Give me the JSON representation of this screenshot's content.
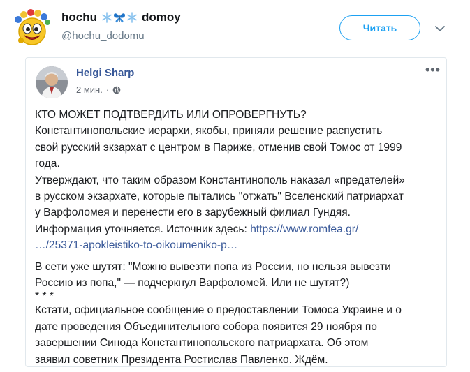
{
  "tweet": {
    "display_name_first": "hochu",
    "display_name_last": "domoy",
    "handle": "@hochu_dodomu",
    "follow_label": "Читать"
  },
  "fb_post": {
    "author": "Helgi Sharp",
    "time": "2 мин.",
    "lines": [
      "КТО МОЖЕТ ПОДТВЕРДИТЬ ИЛИ ОПРОВЕРГНУТЬ?",
      "Константинопольские иерархи, якобы, приняли решение распустить",
      "свой русский экзархат с центром в Париже, отменив свой Томос от 1999",
      "года.",
      "Утверждают, что таким образом Константинополь наказал «предателей»",
      "в русском экзархате, которые пытались \"отжать\" Вселенский патриархат",
      "у Варфоломея и перенести его в зарубежный филиал Гундяя."
    ],
    "info_prefix": "Информация уточняется. Источник здесь: ",
    "link_line1": "https://www.romfea.gr/",
    "link_line2": "…/25371-apokleistiko-to-oikoumeniko-p…",
    "joke_line1": "В сети уже шутят: \"Можно вывезти попа из России, но нельзя вывезти",
    "joke_line2": "Россию из попа,\" — подчеркнул Варфоломей. Или не шутят?)",
    "separator": "* * *",
    "final_lines": [
      "Кстати, официальное сообщение о предоставлении Томоса Украине и о",
      "дате проведения Объединительного собора появится 29 ноября по",
      "завершении Синода Константинопольского патриархата. Об этом",
      "заявил советник Президента Ростислав Павленко. Ждём."
    ]
  },
  "colors": {
    "twitter_blue": "#1da1f2",
    "facebook_link": "#385898",
    "secondary_text": "#657786"
  },
  "icons": [
    "smiley-avatar",
    "snowflake-icon",
    "butterfly-icon",
    "chevron-down-icon",
    "globe-icon",
    "more-options-icon"
  ]
}
